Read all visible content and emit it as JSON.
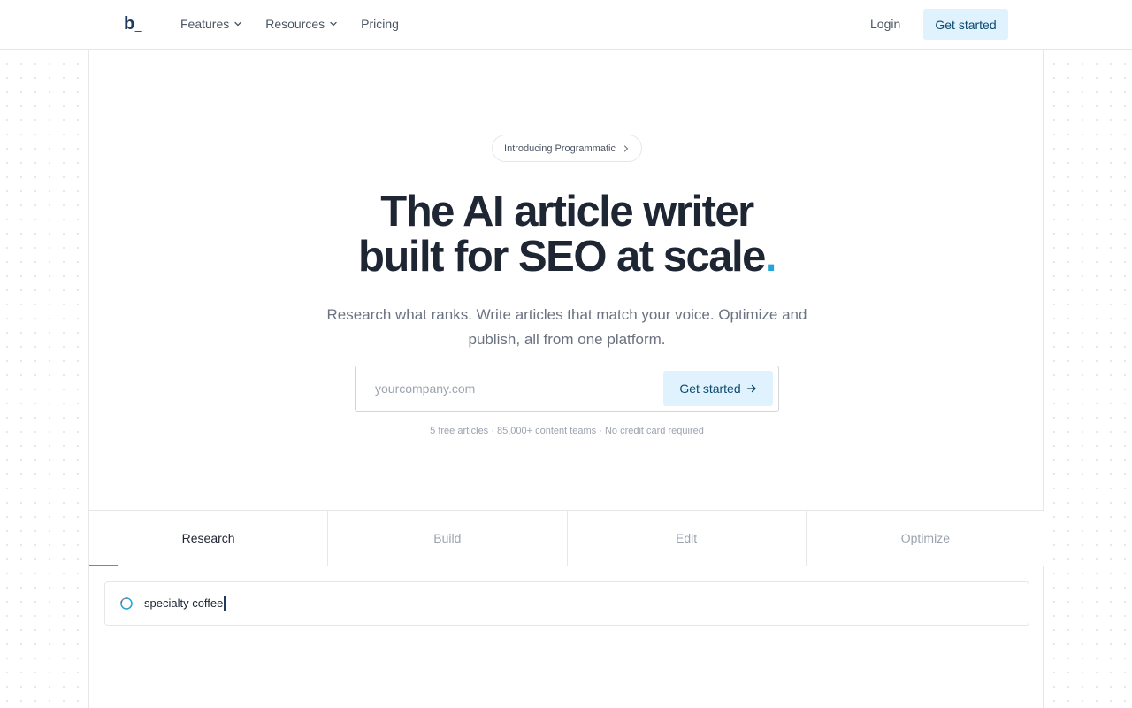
{
  "nav": {
    "logo_main": "b",
    "logo_suffix": "_",
    "links": [
      {
        "label": "Features",
        "has_dropdown": true
      },
      {
        "label": "Resources",
        "has_dropdown": true
      },
      {
        "label": "Pricing",
        "has_dropdown": false
      }
    ],
    "login_label": "Login",
    "cta_label": "Get started"
  },
  "hero": {
    "pill_label": "Introducing Programmatic",
    "title_line1": "The AI article writer",
    "title_line2": "built for SEO at scale",
    "title_dot": ".",
    "subtitle": "Research what ranks. Write articles that match your voice. Optimize and publish, all from one platform.",
    "email_placeholder": "yourcompany.com",
    "cta_label": "Get started",
    "fine_print": "5 free articles · 85,000+ content teams · No credit card required"
  },
  "tabs": {
    "items": [
      {
        "label": "Research",
        "active": true
      },
      {
        "label": "Build",
        "active": false
      },
      {
        "label": "Edit",
        "active": false
      },
      {
        "label": "Optimize",
        "active": false
      }
    ]
  },
  "demo": {
    "search_text": "specialty coffee",
    "spinner_icon": "loading-spinner-icon"
  },
  "colors": {
    "accent": "#22a6d6",
    "cta_bg": "#e0f2fe",
    "cta_text": "#0c4a6e",
    "heading": "#1e2533"
  }
}
